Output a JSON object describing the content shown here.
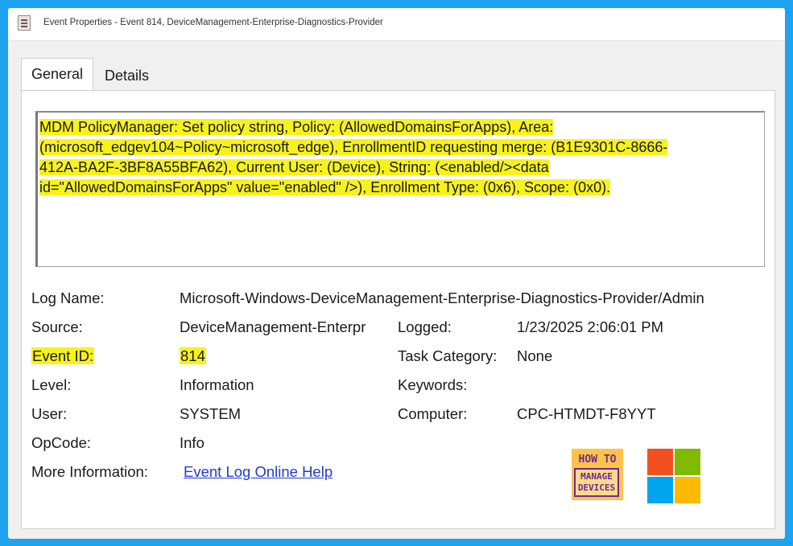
{
  "window": {
    "title": "Event Properties - Event 814, DeviceManagement-Enterprise-Diagnostics-Provider"
  },
  "tabs": [
    {
      "label": "General",
      "active": true
    },
    {
      "label": "Details",
      "active": false
    }
  ],
  "description": {
    "lines": [
      "MDM PolicyManager: Set policy string, Policy: (AllowedDomainsForApps), Area:",
      "(microsoft_edgev104~Policy~microsoft_edge), EnrollmentID requesting merge: (B1E9301C-8666-",
      "412A-BA2F-3BF8A55BFA62), Current User: (Device), String: (<enabled/><data",
      "id=\"AllowedDomainsForApps\" value=\"enabled\" />), Enrollment Type: (0x6), Scope: (0x0)."
    ],
    "highlight_color": "#f7f21c"
  },
  "fields": {
    "log_name": {
      "label": "Log Name:",
      "value": "Microsoft-Windows-DeviceManagement-Enterprise-Diagnostics-Provider/Admin"
    },
    "source": {
      "label": "Source:",
      "value": "DeviceManagement-Enterpr"
    },
    "logged": {
      "label": "Logged:",
      "value": "1/23/2025 2:06:01 PM"
    },
    "event_id": {
      "label": "Event ID:",
      "value": "814"
    },
    "task_category": {
      "label": "Task Category:",
      "value": "None"
    },
    "level": {
      "label": "Level:",
      "value": "Information"
    },
    "keywords": {
      "label": "Keywords:",
      "value": ""
    },
    "user": {
      "label": "User:",
      "value": "SYSTEM"
    },
    "computer": {
      "label": "Computer:",
      "value": "CPC-HTMDT-F8YYT"
    },
    "opcode": {
      "label": "OpCode:",
      "value": "Info"
    },
    "more_info": {
      "label": "More Information:",
      "link": "Event Log Online Help"
    }
  },
  "logos": {
    "htmd_top": "HOW TO",
    "htmd_line1": "MANAGE",
    "htmd_line2": "DEVICES"
  },
  "colors": {
    "frame": "#1ea3ee",
    "link": "#1f3bd1",
    "ms_red": "#f25022",
    "ms_green": "#7fba00",
    "ms_blue": "#00a4ef",
    "ms_yellow": "#ffb900"
  }
}
